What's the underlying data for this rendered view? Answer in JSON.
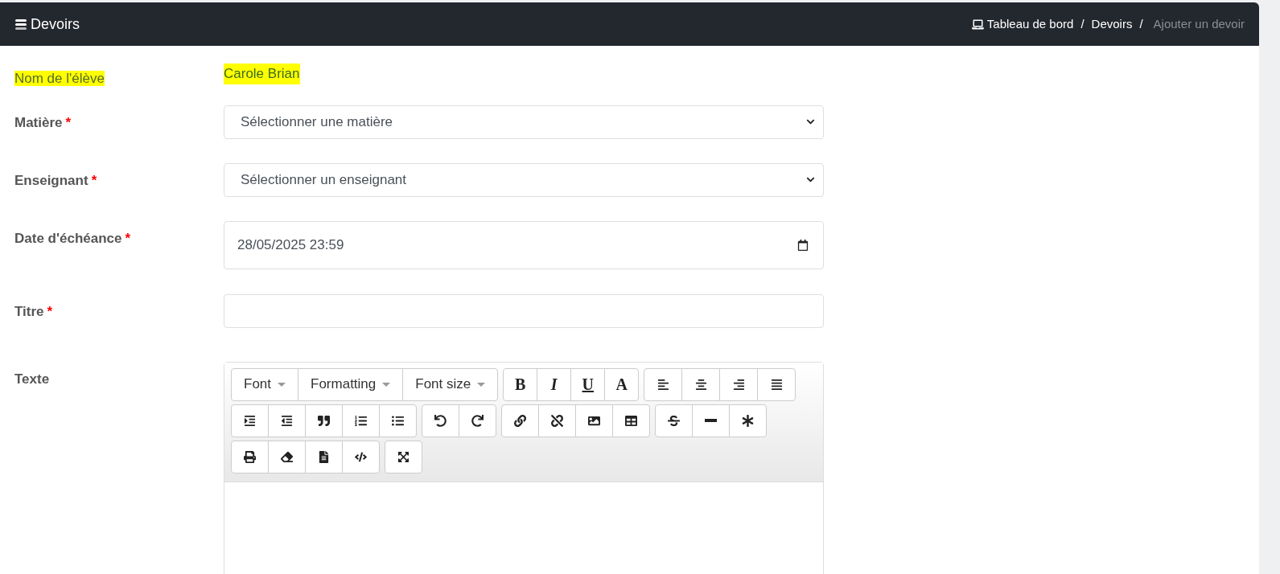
{
  "header": {
    "title": "Devoirs",
    "breadcrumb": [
      {
        "label": "Tableau de bord",
        "kind": "link",
        "icon": true
      },
      {
        "label": "Devoirs",
        "kind": "link",
        "icon": false
      },
      {
        "label": "Ajouter un devoir",
        "kind": "current",
        "icon": false
      }
    ],
    "separator": "/"
  },
  "student": {
    "label": "Nom de l'élève",
    "value": "Carole Brian",
    "highlighted": true
  },
  "fields": [
    {
      "kind": "select",
      "label": "Matière",
      "required": true,
      "value": "Sélectionner une matière"
    },
    {
      "kind": "select",
      "label": "Enseignant",
      "required": true,
      "value": "Sélectionner un enseignant"
    },
    {
      "kind": "datetime",
      "label": "Date d'échéance",
      "required": true,
      "value": "28/05/2025 23:59"
    },
    {
      "kind": "text",
      "label": "Titre",
      "required": true
    },
    {
      "kind": "editor",
      "label": "Texte",
      "required": false
    }
  ],
  "required_mark": "*",
  "editor": {
    "dropdowns": [
      "Font",
      "Formatting",
      "Font size"
    ],
    "glyph_buttons": [
      "B",
      "I",
      "U",
      "A"
    ]
  }
}
